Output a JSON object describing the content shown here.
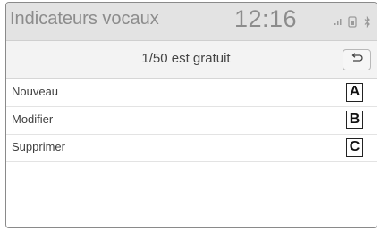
{
  "header": {
    "title": "Indicateurs vocaux",
    "time": "12:16",
    "status_icons": [
      "signal-icon",
      "phone-battery-icon",
      "bluetooth-icon"
    ]
  },
  "subheader": {
    "free_text": "1/50 est gratuit",
    "back_icon": "return-arrow-icon"
  },
  "menu": {
    "items": [
      {
        "label": "Nouveau",
        "marker": "A"
      },
      {
        "label": "Modifier",
        "marker": "B"
      },
      {
        "label": "Supprimer",
        "marker": "C"
      }
    ]
  },
  "colors": {
    "header_bg": "#e3e3e3",
    "subheader_bg": "#f3f3f3",
    "text_grey": "#8c8c8c"
  }
}
